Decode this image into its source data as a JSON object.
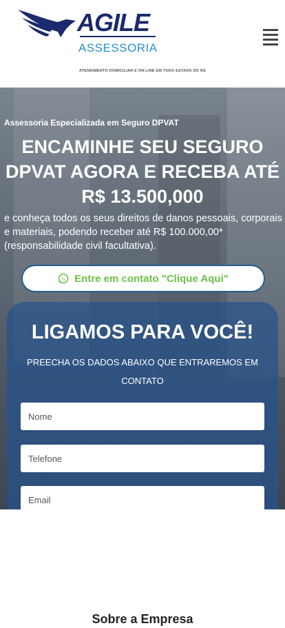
{
  "header": {
    "logo_word": "AGILE",
    "logo_sub": "ASSESSORIA",
    "tagline": "ATENDIMENTO DOMICILIAR E ON-LINE EM TODO ESTADO DO RS",
    "menu_icon": "hamburger-menu-icon"
  },
  "hero": {
    "subtitle": "Assessoria Especializada em Seguro DPVAT",
    "headline": "ENCAMINHE SEU SEGURO DPVAT AGORA E RECEBA ATÉ R$ 13.500,000",
    "description": "e conheça todos os seus direitos de danos pessoais, corporais e materiais, podendo receber até R$ 100.000,00* (responsabilidade civil facultativa).",
    "cta_label": "Entre em contato \"Clique Aqui\"",
    "cta_icon": "whatsapp-icon"
  },
  "form": {
    "title": "LIGAMOS PARA VOCÊ!",
    "subtitle": "PREECHA OS DADOS ABAIXO QUE ENTRAREMOS EM CONTATO",
    "fields": [
      {
        "placeholder": "Nome"
      },
      {
        "placeholder": "Telefone"
      },
      {
        "placeholder": "Email"
      }
    ]
  },
  "about": {
    "title": "Sobre a Empresa"
  },
  "colors": {
    "brand_dark": "#1a2a6c",
    "brand_light": "#2a8fd0",
    "cta_text": "#6cc04a",
    "form_bg": "#26528c"
  }
}
